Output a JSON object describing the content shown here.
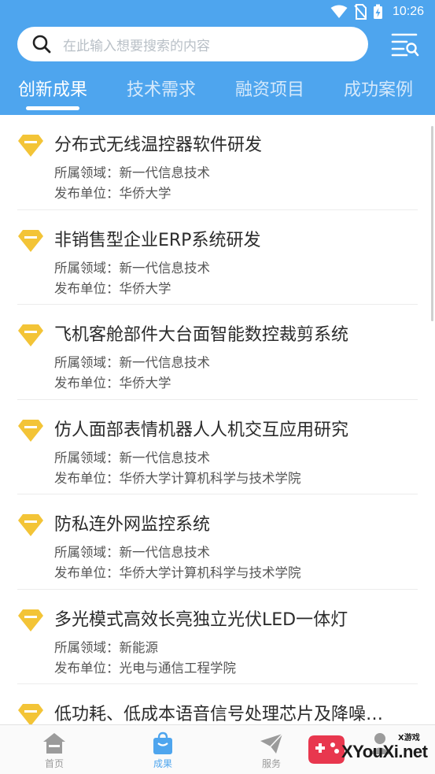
{
  "status_bar": {
    "time": "10:26",
    "icons": [
      "wifi-icon",
      "no-sim-icon",
      "battery-charging-icon"
    ]
  },
  "search": {
    "placeholder": "在此输入想要搜索的内容",
    "search_icon": "search-icon",
    "filter_icon": "filter-list-icon"
  },
  "tabs": [
    {
      "label": "创新成果",
      "active": true
    },
    {
      "label": "技术需求",
      "active": false
    },
    {
      "label": "融资项目",
      "active": false
    },
    {
      "label": "成功案例",
      "active": false
    }
  ],
  "field_label": "所属领域：",
  "unit_label": "发布单位：",
  "items": [
    {
      "title": "分布式无线温控器软件研发",
      "field": "新一代信息技术",
      "unit": "华侨大学"
    },
    {
      "title": "非销售型企业ERP系统研发",
      "field": "新一代信息技术",
      "unit": "华侨大学"
    },
    {
      "title": "飞机客舱部件大台面智能数控裁剪系统",
      "field": "新一代信息技术",
      "unit": "华侨大学"
    },
    {
      "title": "仿人面部表情机器人人机交互应用研究",
      "field": "新一代信息技术",
      "unit": "华侨大学计算机科学与技术学院"
    },
    {
      "title": "防私连外网监控系统",
      "field": "新一代信息技术",
      "unit": "华侨大学计算机科学与技术学院"
    },
    {
      "title": "多光模式高效长亮独立光伏LED一体灯",
      "field": "新能源",
      "unit": "光电与通信工程学院"
    },
    {
      "title": "低功耗、低成本语音信号处理芯片及降噪…",
      "field": "",
      "unit": ""
    }
  ],
  "bottom_nav": [
    {
      "label": "首页",
      "icon": "home-icon",
      "active": false
    },
    {
      "label": "成果",
      "icon": "bag-icon",
      "active": true
    },
    {
      "label": "服务",
      "icon": "paper-plane-icon",
      "active": false
    },
    {
      "label": "",
      "icon": "user-icon",
      "active": false
    }
  ],
  "watermark": {
    "brand": "XYouXi.net",
    "small": "X游戏"
  },
  "colors": {
    "primary": "#4ea5ee",
    "gem": "#f3c437",
    "text": "#2b2b2b"
  }
}
